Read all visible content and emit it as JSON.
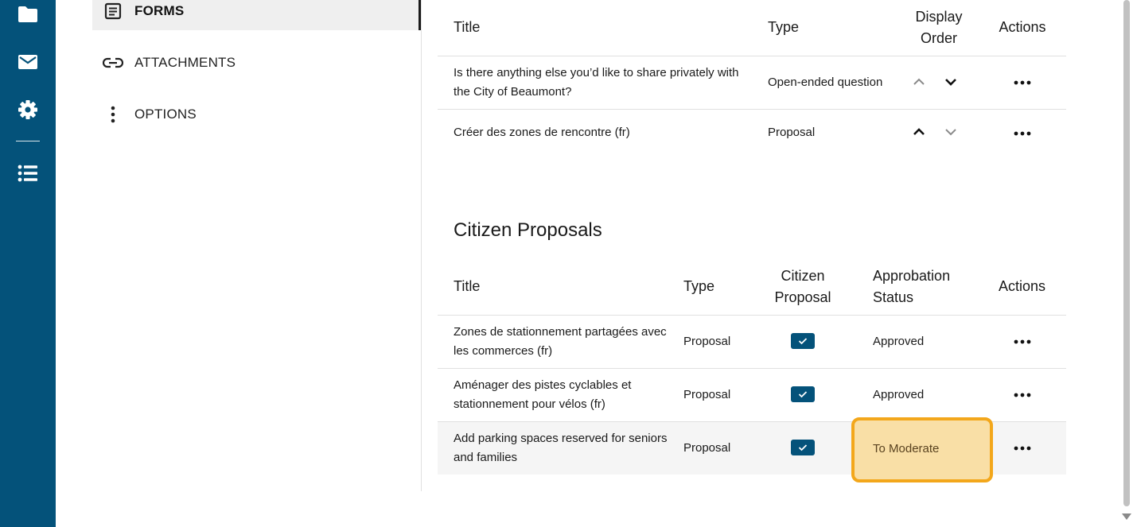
{
  "rail": {
    "icons": [
      "folder-icon",
      "mail-icon",
      "gear-icon",
      "list-icon"
    ]
  },
  "subnav": {
    "items": [
      {
        "label": "FORMS",
        "icon": "form-icon",
        "active": true
      },
      {
        "label": "ATTACHMENTS",
        "icon": "link-icon",
        "active": false
      },
      {
        "label": "OPTIONS",
        "icon": "kebab-icon",
        "active": false
      }
    ]
  },
  "questions_table": {
    "headers": {
      "title": "Title",
      "type": "Type",
      "display_order": "Display Order",
      "actions": "Actions"
    },
    "rows": [
      {
        "title": "Is there anything else you’d like to share privately with the City of Beaumont?",
        "type": "Open-ended question"
      },
      {
        "title": "Créer des zones de rencontre (fr)",
        "type": "Proposal"
      }
    ]
  },
  "citizen_proposals": {
    "heading": "Citizen Proposals",
    "headers": {
      "title": "Title",
      "type": "Type",
      "citizen_proposal": "Citizen Proposal",
      "approbation_status": "Approbation Status",
      "actions": "Actions"
    },
    "rows": [
      {
        "title": "Zones de stationnement partagées avec les commerces (fr)",
        "type": "Proposal",
        "citizen_proposal": true,
        "status": "Approved"
      },
      {
        "title": "Aménager des pistes cyclables et stationnement pour vélos (fr)",
        "type": "Proposal",
        "citizen_proposal": true,
        "status": "Approved"
      },
      {
        "title": "Add parking spaces reserved for seniors and families",
        "type": "Proposal",
        "citizen_proposal": true,
        "status": "To Moderate"
      }
    ]
  },
  "colors": {
    "rail": "#04527a",
    "checkbox": "#04527a",
    "highlight_border": "#f3a71b",
    "highlight_fill": "#f9dfa6"
  }
}
